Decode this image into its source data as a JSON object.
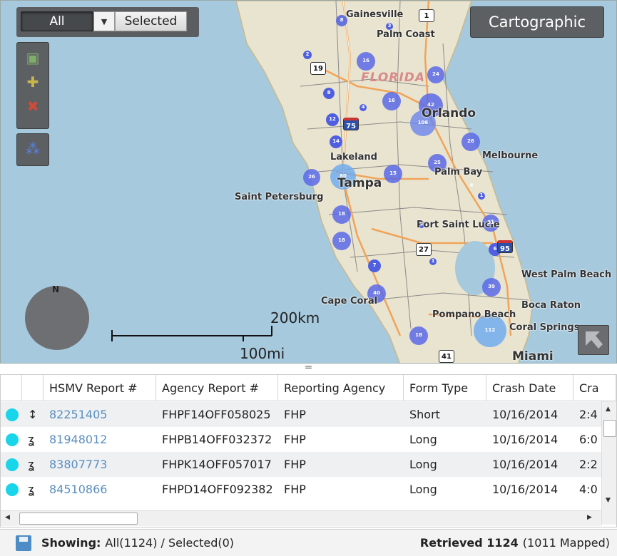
{
  "map": {
    "filter_toggle": {
      "all_label": "All",
      "selected_label": "Selected"
    },
    "basemap_button": "Cartographic",
    "compass_label": "N",
    "scale": {
      "km": "200km",
      "mi": "100mi"
    },
    "region_label": "FLORIDA",
    "cities": [
      {
        "name": "Gainesville",
        "size": "small"
      },
      {
        "name": "Palm Coast",
        "size": "small"
      },
      {
        "name": "Orlando",
        "size": "big"
      },
      {
        "name": "Melbourne",
        "size": "small"
      },
      {
        "name": "Lakeland",
        "size": "small"
      },
      {
        "name": "Palm Bay",
        "size": "small"
      },
      {
        "name": "Tampa",
        "size": "big"
      },
      {
        "name": "Saint Petersburg",
        "size": "small"
      },
      {
        "name": "Port Saint Lucie",
        "size": "small"
      },
      {
        "name": "West Palm Beach",
        "size": "small"
      },
      {
        "name": "Cape Coral",
        "size": "small"
      },
      {
        "name": "Boca Raton",
        "size": "small"
      },
      {
        "name": "Pompano Beach",
        "size": "small"
      },
      {
        "name": "Coral Springs",
        "size": "small"
      },
      {
        "name": "Miami",
        "size": "big"
      }
    ],
    "highway_shields": [
      "1",
      "19",
      "75",
      "27",
      "95",
      "41"
    ],
    "clusters": [
      "8",
      "3",
      "2",
      "16",
      "24",
      "8",
      "16",
      "42",
      "4",
      "12",
      "106",
      "14",
      "26",
      "25",
      "26",
      "80",
      "15",
      "18",
      "2",
      "1",
      "31",
      "18",
      "6",
      "7",
      "1",
      "40",
      "39",
      "18",
      "112",
      "4"
    ]
  },
  "grid": {
    "columns": [
      "HSMV Report #",
      "Agency Report #",
      "Reporting Agency",
      "Form Type",
      "Crash Date",
      "Cra"
    ],
    "rows": [
      {
        "hsmv": "82251405",
        "agency_report": "FHPF14OFF058025",
        "agency": "FHP",
        "form": "Short",
        "date": "10/16/2014",
        "time": "2:4"
      },
      {
        "hsmv": "81948012",
        "agency_report": "FHPB14OFF032372",
        "agency": "FHP",
        "form": "Long",
        "date": "10/16/2014",
        "time": "6:0"
      },
      {
        "hsmv": "83807773",
        "agency_report": "FHPK14OFF057017",
        "agency": "FHP",
        "form": "Long",
        "date": "10/16/2014",
        "time": "2:2"
      },
      {
        "hsmv": "84510866",
        "agency_report": "FHPD14OFF092382",
        "agency": "FHP",
        "form": "Long",
        "date": "10/16/2014",
        "time": "4:0"
      }
    ]
  },
  "status": {
    "showing_label": "Showing:",
    "showing_value": "All(1124) / Selected(0)",
    "retrieved_label": "Retrieved 1124",
    "mapped_value": "(1011 Mapped)"
  },
  "colors": {
    "cluster": "#4f5fe0",
    "cluster_large": "#6aa9f0",
    "selection_dot": "#19d5ea",
    "link": "#5a8fc0"
  }
}
